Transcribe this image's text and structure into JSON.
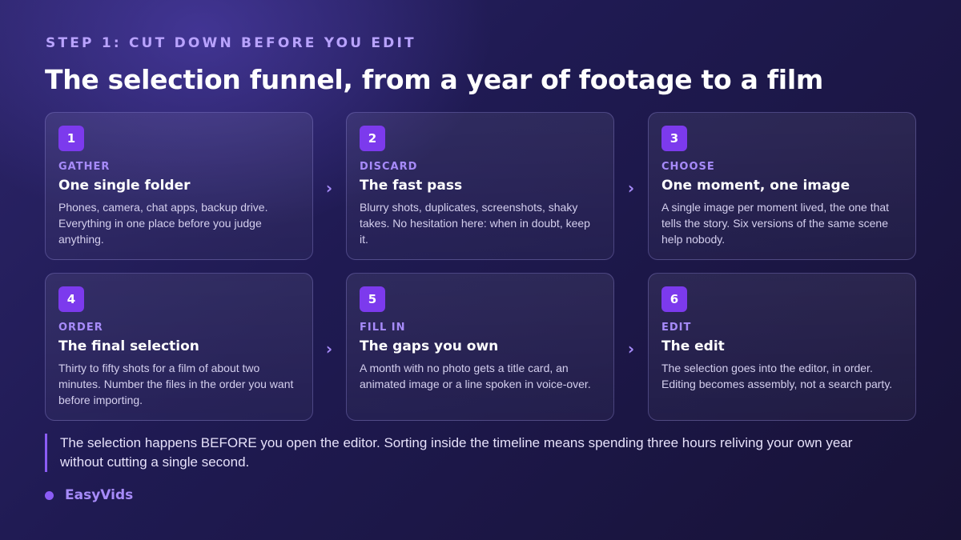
{
  "eyebrow": "STEP 1: CUT DOWN BEFORE YOU EDIT",
  "title": "The selection funnel, from a year of footage to a film",
  "steps": [
    {
      "number": "1",
      "label": "GATHER",
      "heading": "One single folder",
      "description": "Phones, camera, chat apps, backup drive. Everything in one place before you judge anything."
    },
    {
      "number": "2",
      "label": "DISCARD",
      "heading": "The fast pass",
      "description": "Blurry shots, duplicates, screenshots, shaky takes. No hesitation here: when in doubt, keep it."
    },
    {
      "number": "3",
      "label": "CHOOSE",
      "heading": "One moment, one image",
      "description": "A single image per moment lived, the one that tells the story. Six versions of the same scene help nobody."
    },
    {
      "number": "4",
      "label": "ORDER",
      "heading": "The final selection",
      "description": "Thirty to fifty shots for a film of about two minutes. Number the files in the order you want before importing."
    },
    {
      "number": "5",
      "label": "FILL IN",
      "heading": "The gaps you own",
      "description": "A month with no photo gets a title card, an animated image or a line spoken in voice-over."
    },
    {
      "number": "6",
      "label": "EDIT",
      "heading": "The edit",
      "description": "The selection goes into the editor, in order. Editing becomes assembly, not a search party."
    }
  ],
  "arrow_glyph": "›",
  "note": "The selection happens BEFORE you open the editor. Sorting inside the timeline means spending three hours reliving your own year without cutting a single second.",
  "brand": "EasyVids",
  "colors": {
    "accent": "#7c3aed",
    "label": "#a78bfa",
    "background": "#1f1a52"
  }
}
